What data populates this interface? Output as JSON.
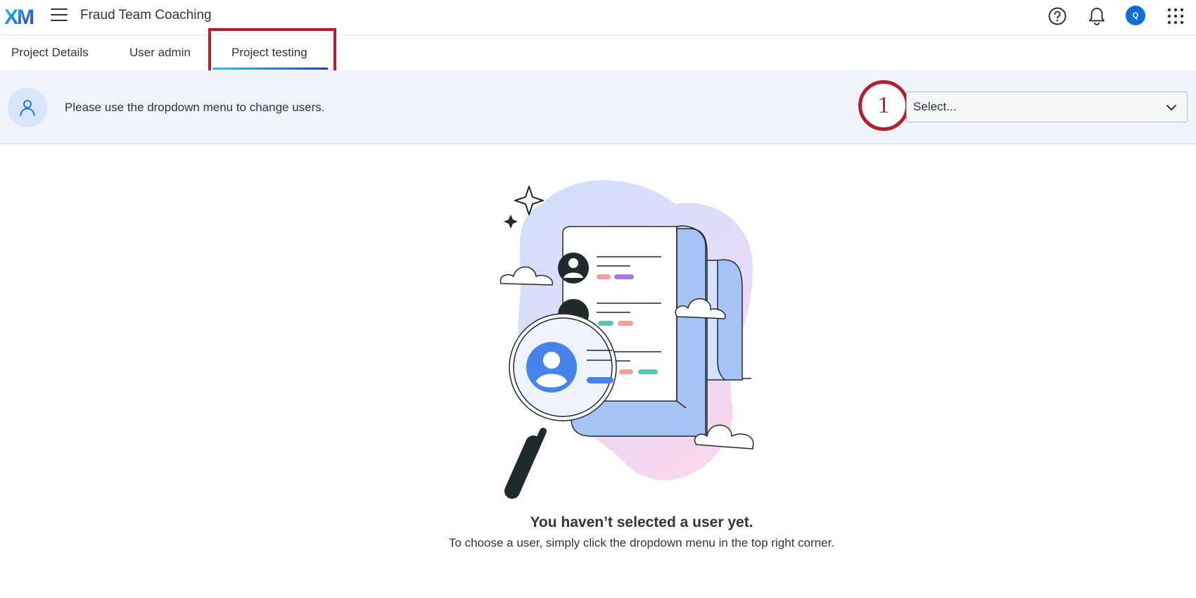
{
  "header": {
    "logo_text": "XM",
    "app_title": "Fraud Team Coaching",
    "icons": [
      "menu-icon",
      "help-icon",
      "bell-icon",
      "grid-icon"
    ],
    "avatar_initial": "Q",
    "avatar_color": "#0b6ed9"
  },
  "tabs": [
    {
      "label": "Project Details",
      "active": false
    },
    {
      "label": "User admin",
      "active": false
    },
    {
      "label": "Project testing",
      "active": true
    }
  ],
  "infobar": {
    "message": "Please use the dropdown menu to change users.",
    "step_number": "1",
    "select": {
      "value": "Select..."
    }
  },
  "empty_state": {
    "title": "You haven’t selected a user yet.",
    "subtitle": "To choose a user, simply click the dropdown menu in the top right corner."
  },
  "colors": {
    "annotation_red": "#b2202f",
    "infobar_bg": "#eff4fc",
    "accent_blue": "#0b6ed9"
  }
}
